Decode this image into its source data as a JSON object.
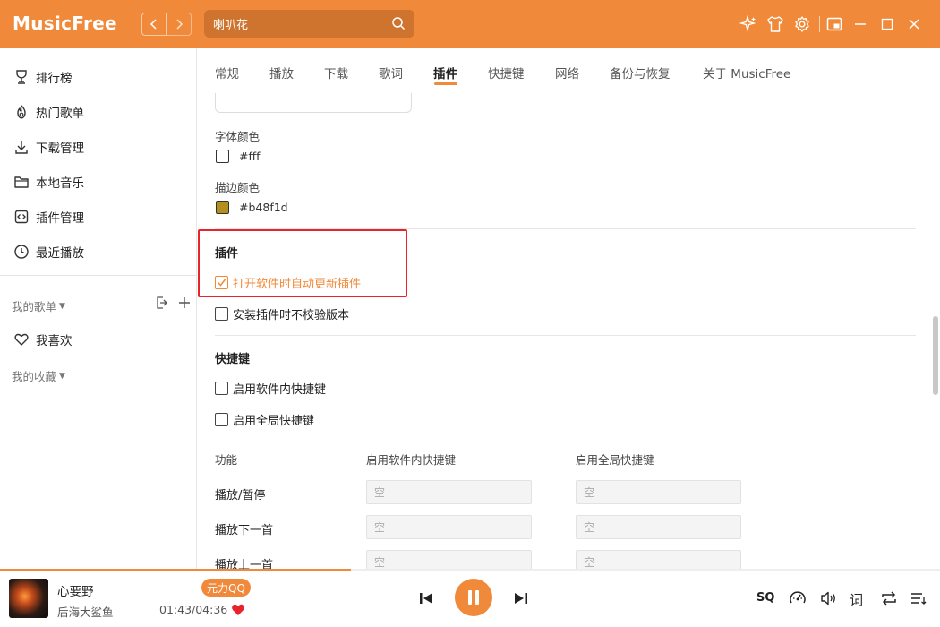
{
  "app": {
    "title": "MusicFree"
  },
  "search": {
    "value": "喇叭花",
    "placeholder": ""
  },
  "sidebar": {
    "items": [
      {
        "label": "排行榜",
        "icon": "trophy-icon"
      },
      {
        "label": "热门歌单",
        "icon": "fire-icon"
      },
      {
        "label": "下载管理",
        "icon": "download-icon"
      },
      {
        "label": "本地音乐",
        "icon": "folder-icon"
      },
      {
        "label": "插件管理",
        "icon": "plugin-icon"
      },
      {
        "label": "最近播放",
        "icon": "clock-icon"
      }
    ],
    "my_playlists": "我的歌单",
    "favorite": "我喜欢",
    "my_collections": "我的收藏"
  },
  "tabs": [
    "常规",
    "播放",
    "下载",
    "歌词",
    "插件",
    "快捷键",
    "网络",
    "备份与恢复",
    "关于 MusicFree"
  ],
  "active_tab": "插件",
  "settings": {
    "font_color_label": "字体颜色",
    "font_color_value": "#fff",
    "font_color": "#ffffff",
    "stroke_color_label": "描边颜色",
    "stroke_color_value": "#b48f1d",
    "stroke_color": "#b48f1d",
    "plugin_section": "插件",
    "plugin_auto_update": "打开软件时自动更新插件",
    "plugin_auto_update_checked": true,
    "plugin_no_verify": "安装插件时不校验版本",
    "plugin_no_verify_checked": false,
    "shortcut_section": "快捷键",
    "shortcut_in_app": "启用软件内快捷键",
    "shortcut_global": "启用全局快捷键",
    "col_function": "功能",
    "col_in_app": "启用软件内快捷键",
    "col_global": "启用全局快捷键",
    "rows": [
      {
        "label": "播放/暂停",
        "in_app": "空",
        "global": "空"
      },
      {
        "label": "播放下一首",
        "in_app": "空",
        "global": "空"
      },
      {
        "label": "播放上一首",
        "in_app": "空",
        "global": "空"
      }
    ]
  },
  "player": {
    "title": "心要野",
    "artist": "后海大鲨鱼",
    "badge": "元力QQ",
    "time": "01:43/04:36",
    "progress": 0.373,
    "quality": "SQ",
    "lyric": "词"
  },
  "colors": {
    "accent": "#f08a3a",
    "highlight": "#e8232b"
  }
}
